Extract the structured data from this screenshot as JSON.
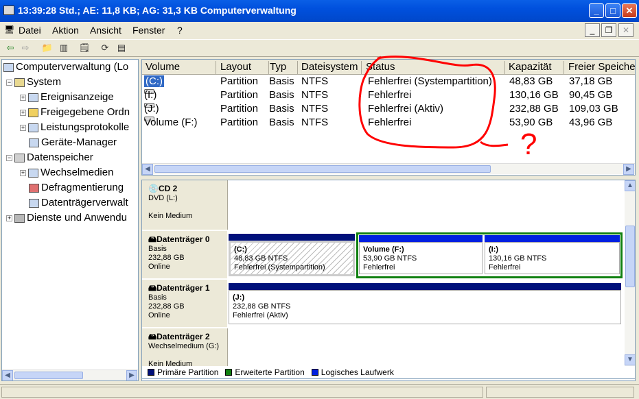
{
  "window": {
    "title": "13:39:28 Std.; AE: 11,8 KB; AG: 31,3 KB Computerverwaltung"
  },
  "menu": [
    "Datei",
    "Aktion",
    "Ansicht",
    "Fenster",
    "?"
  ],
  "tree": {
    "root": "Computerverwaltung (Lo",
    "system": "System",
    "event": "Ereignisanzeige",
    "shares": "Freigegebene Ordn",
    "perf": "Leistungsprotokolle",
    "devices": "Geräte-Manager",
    "storage": "Datenspeicher",
    "removable": "Wechselmedien",
    "defrag": "Defragmentierung",
    "diskmgmt": "Datenträgerverwalt",
    "services": "Dienste und Anwendu"
  },
  "columns": [
    "Volume",
    "Layout",
    "Typ",
    "Dateisystem",
    "Status",
    "Kapazität",
    "Freier Speiche"
  ],
  "rows": [
    {
      "volume": "(C:)",
      "layout": "Partition",
      "typ": "Basis",
      "fs": "NTFS",
      "status": "Fehlerfrei (Systempartition)",
      "cap": "48,83 GB",
      "free": "37,18 GB"
    },
    {
      "volume": "(I:)",
      "layout": "Partition",
      "typ": "Basis",
      "fs": "NTFS",
      "status": "Fehlerfrei",
      "cap": "130,16 GB",
      "free": "90,45 GB"
    },
    {
      "volume": "(J:)",
      "layout": "Partition",
      "typ": "Basis",
      "fs": "NTFS",
      "status": "Fehlerfrei (Aktiv)",
      "cap": "232,88 GB",
      "free": "109,03 GB"
    },
    {
      "volume": "Volume (F:)",
      "layout": "Partition",
      "typ": "Basis",
      "fs": "NTFS",
      "status": "Fehlerfrei",
      "cap": "53,90 GB",
      "free": "43,96 GB"
    }
  ],
  "annotation": {
    "mark": "?"
  },
  "disks": {
    "cd2": {
      "name": "CD 2",
      "l1": "DVD (L:)",
      "l2": "Kein Medium"
    },
    "d0": {
      "name": "Datenträger 0",
      "l1": "Basis",
      "l2": "232,88 GB",
      "l3": "Online",
      "p1": {
        "name": "(C:)",
        "size": "48,83 GB NTFS",
        "status": "Fehlerfrei (Systempartition)"
      },
      "p2": {
        "name": "Volume  (F:)",
        "size": "53,90 GB NTFS",
        "status": "Fehlerfrei"
      },
      "p3": {
        "name": "(I:)",
        "size": "130,16 GB NTFS",
        "status": "Fehlerfrei"
      }
    },
    "d1": {
      "name": "Datenträger 1",
      "l1": "Basis",
      "l2": "232,88 GB",
      "l3": "Online",
      "p1": {
        "name": "(J:)",
        "size": "232,88 GB NTFS",
        "status": "Fehlerfrei (Aktiv)"
      }
    },
    "d2": {
      "name": "Datenträger 2",
      "l1": "Wechselmedium (G:)",
      "l2": "Kein Medium"
    }
  },
  "legend": {
    "primary": "Primäre Partition",
    "extended": "Erweiterte Partition",
    "logical": "Logisches Laufwerk"
  },
  "colors": {
    "primary": "#00107a",
    "extended": "#108010",
    "logical": "#0020e0",
    "annotation": "#ff0000"
  }
}
